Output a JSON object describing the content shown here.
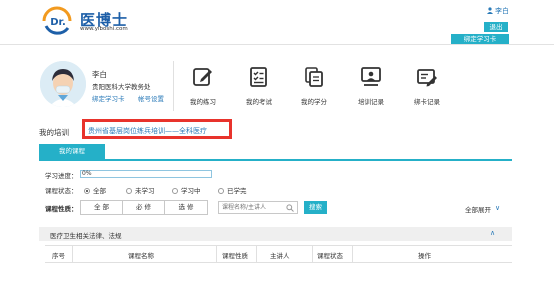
{
  "header": {
    "logo_badge": "Dr.",
    "logo_cn": "医博士",
    "logo_url": "www.yiboshi.com",
    "user_name": "李白",
    "exit_label": "退出",
    "bind_label": "绑定学习卡"
  },
  "profile": {
    "name": "李白",
    "org": "贵阳医科大学教务处",
    "link_bind": "绑定学习卡",
    "link_settings": "帐号设置"
  },
  "nav": [
    {
      "label": "我的练习",
      "icon": "edit-icon"
    },
    {
      "label": "我的考试",
      "icon": "checklist-icon"
    },
    {
      "label": "我的学分",
      "icon": "documents-icon"
    },
    {
      "label": "培训记录",
      "icon": "presenter-icon"
    },
    {
      "label": "绑卡记录",
      "icon": "card-edit-icon"
    }
  ],
  "training": {
    "label": "我的培训",
    "name": "贵州省基层岗位练兵培训——全科医疗"
  },
  "tabs": {
    "active": "我的课程"
  },
  "progress": {
    "label": "学习进度：",
    "value_text": "0%",
    "value": 0
  },
  "status": {
    "label": "课程状态：",
    "options": [
      "全部",
      "未学习",
      "学习中",
      "已学完"
    ],
    "selected": "全部"
  },
  "type_filter": {
    "label": "课程性质：",
    "options": [
      "全 部",
      "必 修",
      "选 修"
    ]
  },
  "search": {
    "placeholder": "课程名称/主讲人",
    "button": "搜索"
  },
  "expand_all": "全部展开",
  "category": {
    "name": "医疗卫生相关法律、法规"
  },
  "table": {
    "columns": [
      "序号",
      "课程名称",
      "课程性质",
      "主讲人",
      "课程状态",
      "操作"
    ]
  },
  "colors": {
    "accent": "#25b0c8",
    "link": "#2a7ab8",
    "highlight": "#e8332c",
    "brand": "#1d5fa8"
  }
}
